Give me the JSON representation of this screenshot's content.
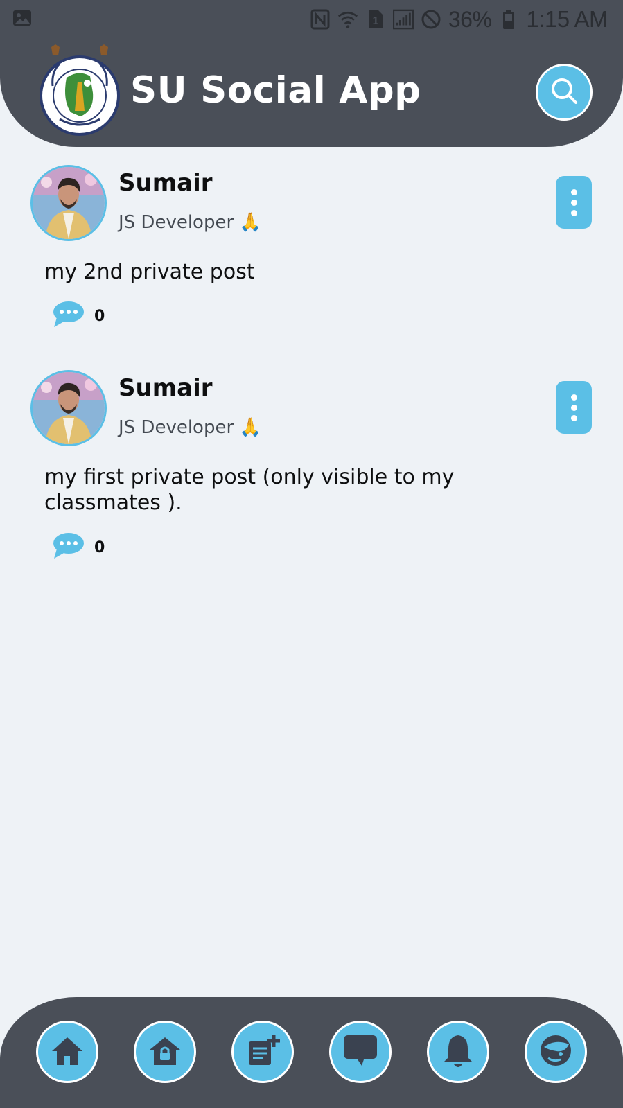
{
  "status_bar": {
    "battery_percent": "36%",
    "time": "1:15 AM",
    "sim_label": "1"
  },
  "header": {
    "title": "SU Social App",
    "logo_icon": "university-of-sindh-logo",
    "search_icon": "search-icon"
  },
  "posts": [
    {
      "author": "Sumair",
      "role": "JS Developer",
      "role_emoji": "🙏",
      "text": "my 2nd private post",
      "comment_count": "0"
    },
    {
      "author": "Sumair",
      "role": "JS Developer",
      "role_emoji": "🙏",
      "text": "my first private post (only visible to my classmates ).",
      "comment_count": "0"
    }
  ],
  "bottom_nav": [
    {
      "icon": "home-icon"
    },
    {
      "icon": "private-home-icon"
    },
    {
      "icon": "create-post-icon"
    },
    {
      "icon": "chat-icon"
    },
    {
      "icon": "bell-icon"
    },
    {
      "icon": "profile-icon"
    }
  ],
  "colors": {
    "header_bg": "#4a4f58",
    "accent": "#5bbfe6",
    "page_bg": "#eef2f6"
  }
}
